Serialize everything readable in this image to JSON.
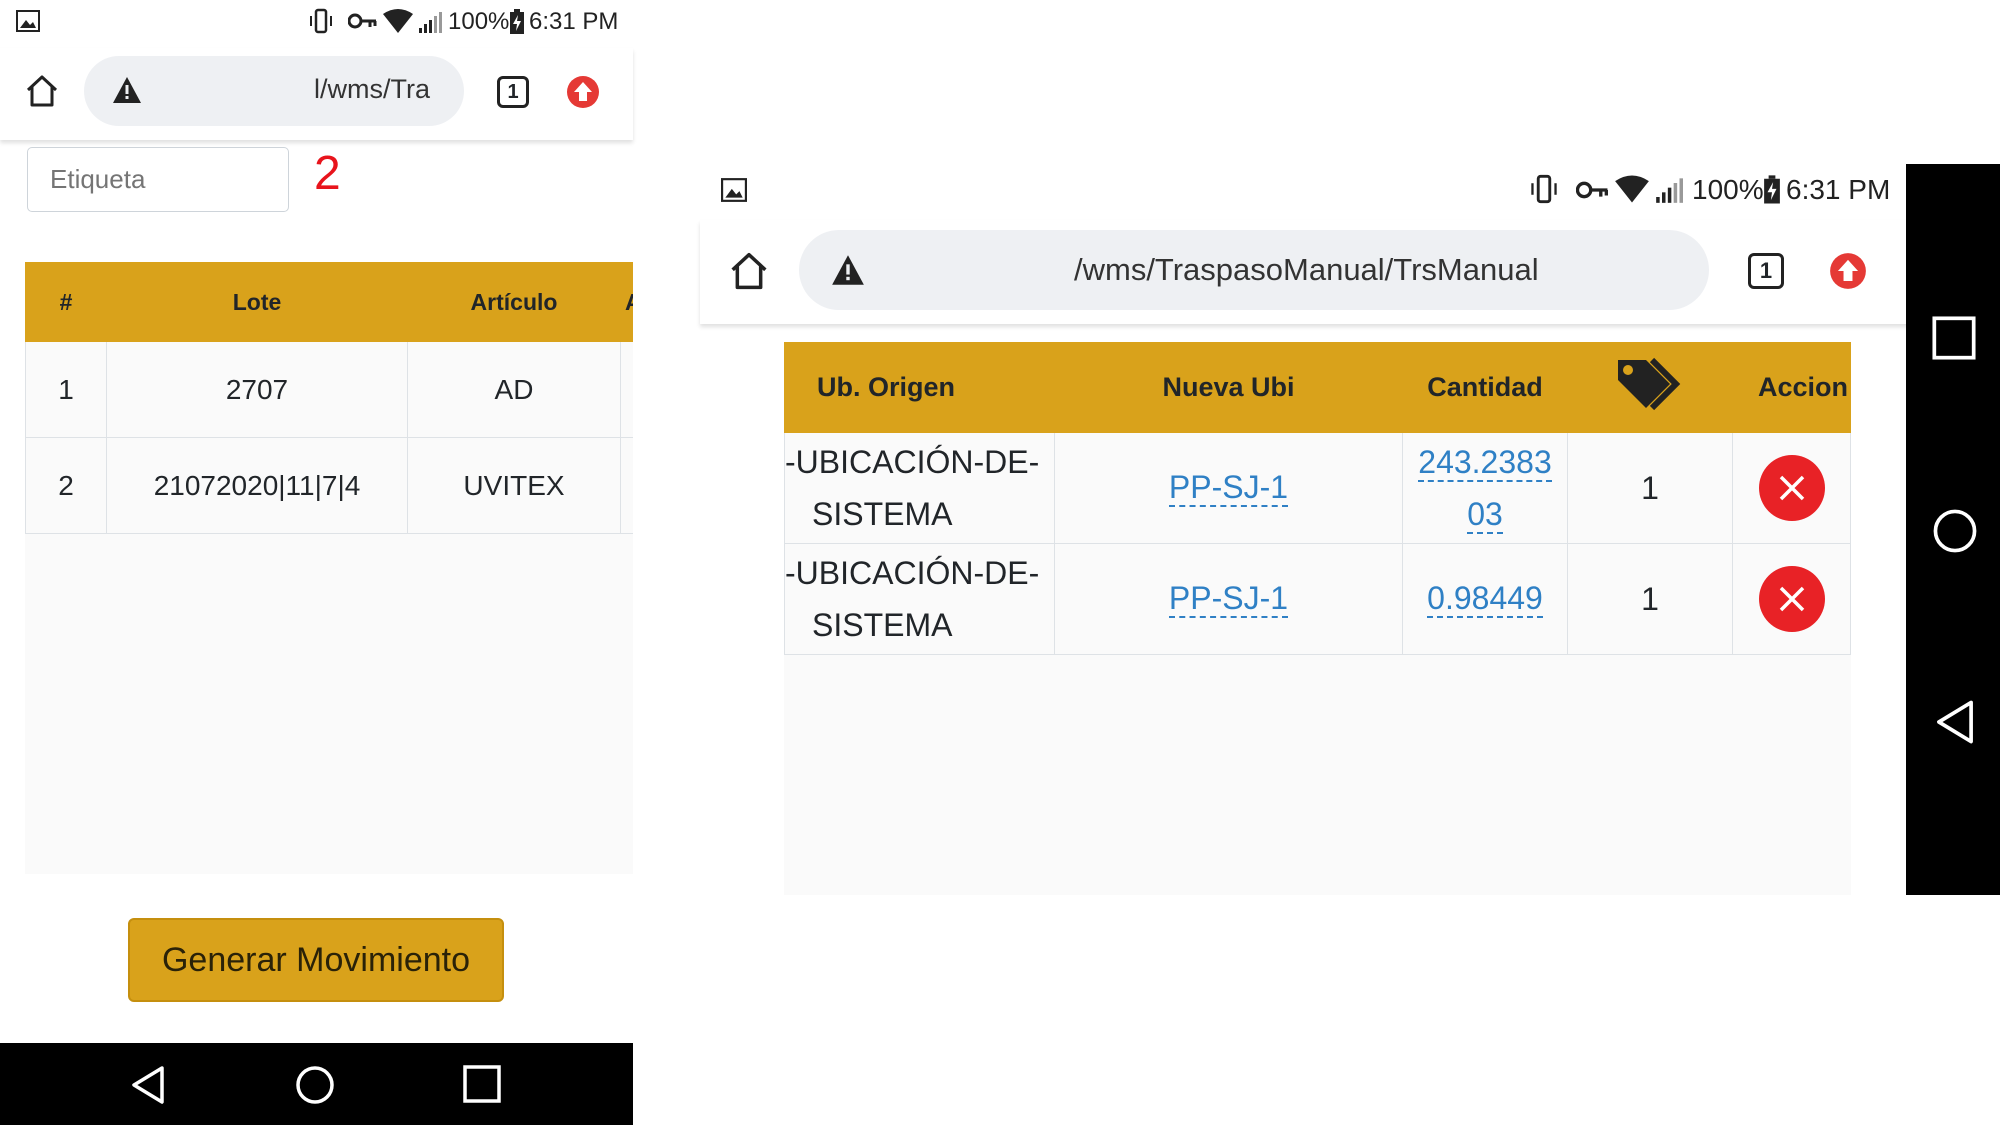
{
  "left": {
    "status": {
      "battery": "100%",
      "time": "6:31 PM"
    },
    "browser": {
      "url": "l/wms/Tra",
      "tab_count": "1"
    },
    "etiqueta_placeholder": "Etiqueta",
    "step_number": "2",
    "table": {
      "headers": [
        "#",
        "Lote",
        "Artículo",
        "A"
      ],
      "rows": [
        [
          "1",
          "2707",
          "AD"
        ],
        [
          "2",
          "21072020|11|7|4",
          "UVITEX"
        ]
      ]
    },
    "button_label": "Generar Movimiento"
  },
  "right": {
    "status": {
      "battery": "100%",
      "time": "6:31 PM"
    },
    "browser": {
      "url": "/wms/TraspasoManual/TrsManual",
      "tab_count": "1"
    },
    "table": {
      "headers": [
        "Ub. Origen",
        "Nueva Ubi",
        "Cantidad",
        "tag-icon",
        "Accion"
      ],
      "rows": [
        {
          "origen_1": "-UBICACIÓN-DE-",
          "origen_2": "SISTEMA",
          "nueva": "PP-SJ-1",
          "cantidad_1": "243.2383",
          "cantidad_2": "03",
          "etiquetas": "1"
        },
        {
          "origen_1": "-UBICACIÓN-DE-",
          "origen_2": "SISTEMA",
          "nueva": "PP-SJ-1",
          "cantidad_1": "0.98449",
          "cantidad_2": "",
          "etiquetas": "1"
        }
      ]
    }
  },
  "colors": {
    "header_gold": "#d9a21b",
    "link_blue": "#2f80c5",
    "delete_red": "#e82226",
    "step_red": "#e8141c"
  }
}
